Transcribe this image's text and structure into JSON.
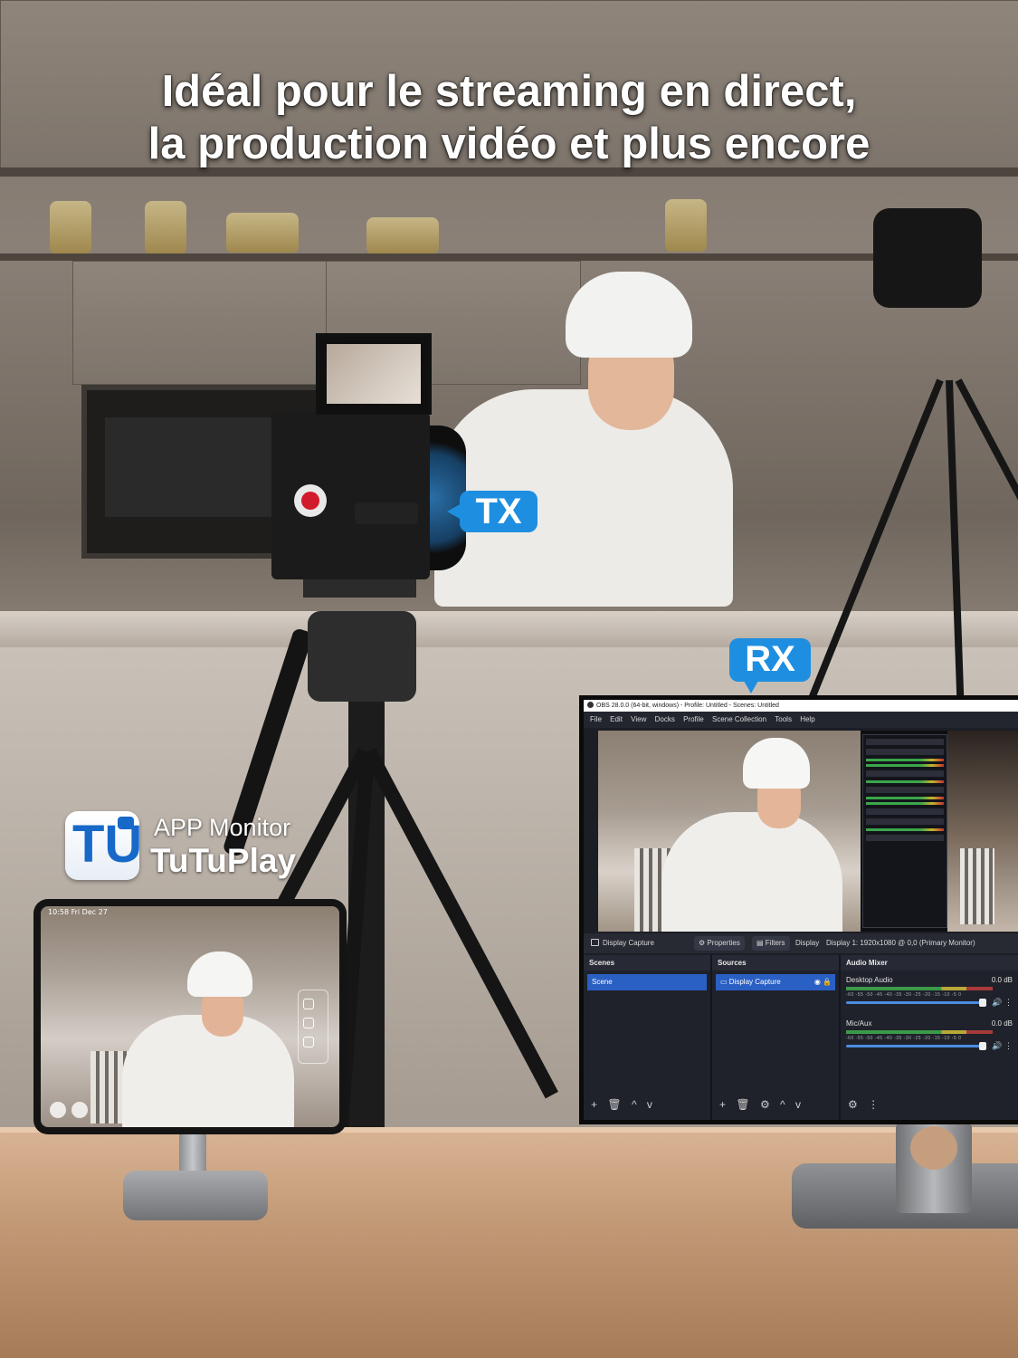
{
  "headline": {
    "line1": "Idéal pour le streaming en direct,",
    "line2": "la production vidéo et plus encore"
  },
  "callouts": {
    "tx": "TX",
    "rx": "RX",
    "color": "#1e8fe0"
  },
  "app_logo": {
    "glyph": "TU",
    "line1": "APP Monitor",
    "line2": "TuTuPlay"
  },
  "tablet": {
    "status": "10:58   Fri Dec 27"
  },
  "obs": {
    "window_title": "OBS 28.0.0 (64-bit, windows) - Profile: Untitled - Scenes: Untitled",
    "menu": [
      "File",
      "Edit",
      "View",
      "Docks",
      "Profile",
      "Scene Collection",
      "Tools",
      "Help"
    ],
    "source_bar": {
      "source_name": "Display Capture",
      "properties": "Properties",
      "filters": "Filters",
      "display_label": "Display",
      "display_value": "Display 1: 1920x1080 @ 0,0 (Primary Monitor)"
    },
    "docks": {
      "scenes": {
        "title": "Scenes",
        "items": [
          "Scene"
        ]
      },
      "sources": {
        "title": "Sources",
        "items": [
          "Display Capture"
        ]
      },
      "audio_mixer": {
        "title": "Audio Mixer",
        "channels": [
          {
            "name": "Desktop Audio",
            "level": "0.0 dB"
          },
          {
            "name": "Mic/Aux",
            "level": "0.0 dB"
          }
        ],
        "scale": "-60  -55  -50  -45  -40  -35  -30  -25  -20  -15  -10  -5  0"
      }
    },
    "foot_icons": {
      "add": "+",
      "remove": "🗑",
      "settings": "⚙",
      "up": "^",
      "down": "v",
      "menu": "⋮"
    }
  }
}
